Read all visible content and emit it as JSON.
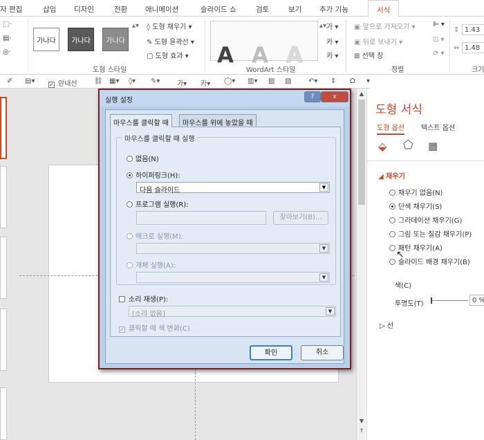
{
  "ribbon_tabs": [
    "자 편집",
    "삽입",
    "디자인",
    "전환",
    "애니메이션",
    "슬라이드 쇼",
    "검토",
    "보기",
    "추가 기능",
    "서식"
  ],
  "active_tab": "서식",
  "ribbon": {
    "shape_styles": {
      "labels": [
        "가나다",
        "가나다",
        "가나다"
      ],
      "fill": "도형 채우기",
      "outline": "도형 윤곽선",
      "effect": "도형 효과",
      "group": "도형 스타일"
    },
    "wordart": {
      "letters": [
        "A",
        "A",
        "A"
      ],
      "group": "WordArt 스타일"
    },
    "arrange": {
      "bring_forward": "앞으로 가져오기",
      "send_backward": "뒤로 보내기",
      "selection_pane": "선택 창",
      "group": "정렬"
    },
    "size": {
      "height": "1.43",
      "width": "1.48",
      "group": "크기"
    }
  },
  "quick_access": {
    "gridlines_label": "안내선"
  },
  "dialog": {
    "title": "실행 설정",
    "help_btn": "?",
    "close_btn": "x",
    "tabs": [
      "마우스를 클릭할 때",
      "마우스를 위에 놓았을 때"
    ],
    "group_label": "마우스를 클릭할 때 실행",
    "options": {
      "none": "없음(N)",
      "hyperlink": "하이퍼링크(H):",
      "hyperlink_value": "다음 슬라이드",
      "run_program": "프로그램 실행(R):",
      "browse": "찾아보기(B)...",
      "run_macro": "매크로 실행(M):",
      "object_action": "개체 실행(A):"
    },
    "play_sound": "소리 재생(P):",
    "sound_value": "[소리 없음]",
    "highlight": "클릭할 때 색 변화(C)",
    "ok": "확인",
    "cancel": "취소"
  },
  "format_pane": {
    "title": "도형 서식",
    "tab_shape": "도형 옵션",
    "tab_text": "텍스트 옵션",
    "fill_section": "채우기",
    "fill_options": [
      "채우기 없음(N)",
      "단색 채우기(S)",
      "그라데이션 채우기(G)",
      "그림 또는 질감 채우기(P)",
      "패턴 채우기(A)",
      "슬라이드 배경 채우기(B)"
    ],
    "selected_fill": 1,
    "color_label": "색(C)",
    "transparency_label": "투명도(T)",
    "transparency_value": "0 %",
    "line_section": "선"
  },
  "colors": {
    "accent": "#d24726",
    "dialog_border": "#7a1d1d"
  }
}
